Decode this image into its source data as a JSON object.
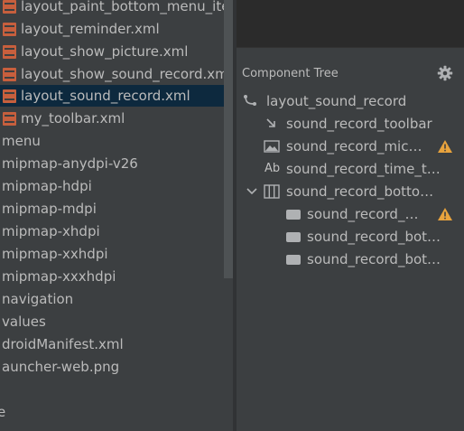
{
  "project_tree": {
    "items": [
      {
        "label": "layout_paint_bottom_menu_item",
        "icon": "xml-icon",
        "selected": false
      },
      {
        "label": "layout_reminder.xml",
        "icon": "xml-icon",
        "selected": false
      },
      {
        "label": "layout_show_picture.xml",
        "icon": "xml-icon",
        "selected": false
      },
      {
        "label": "layout_show_sound_record.xml",
        "icon": "xml-icon",
        "selected": false
      },
      {
        "label": "layout_sound_record.xml",
        "icon": "xml-icon",
        "selected": true
      },
      {
        "label": "my_toolbar.xml",
        "icon": "xml-icon",
        "selected": false
      },
      {
        "label": "menu",
        "icon": "",
        "selected": false
      },
      {
        "label": "mipmap-anydpi-v26",
        "icon": "",
        "selected": false
      },
      {
        "label": "mipmap-hdpi",
        "icon": "",
        "selected": false
      },
      {
        "label": "mipmap-mdpi",
        "icon": "",
        "selected": false
      },
      {
        "label": "mipmap-xhdpi",
        "icon": "",
        "selected": false
      },
      {
        "label": "mipmap-xxhdpi",
        "icon": "",
        "selected": false
      },
      {
        "label": "mipmap-xxxhdpi",
        "icon": "",
        "selected": false
      },
      {
        "label": "navigation",
        "icon": "",
        "selected": false
      },
      {
        "label": "values",
        "icon": "",
        "selected": false
      },
      {
        "label": "droidManifest.xml",
        "icon": "",
        "selected": false
      },
      {
        "label": "auncher-web.png",
        "icon": "",
        "selected": false
      },
      {
        "label": "e",
        "icon": "",
        "selected": false
      }
    ]
  },
  "component_tree": {
    "title": "Component Tree",
    "settings_icon": "gear-icon",
    "items": [
      {
        "label": "layout_sound_record",
        "icon": "constraint-layout-icon",
        "warning": false
      },
      {
        "label": "sound_record_toolbar",
        "icon": "include-arrow-icon",
        "warning": false
      },
      {
        "label": "sound_record_mic…",
        "icon": "image-view-icon",
        "warning": true
      },
      {
        "label": "sound_record_time_t…",
        "icon": "text-view-icon",
        "icon_text": "Ab",
        "warning": false
      },
      {
        "label": "sound_record_botto…",
        "icon": "linear-layout-icon",
        "warning": false,
        "expanded": true
      },
      {
        "label": "sound_record_…",
        "icon": "button-icon",
        "warning": true
      },
      {
        "label": "sound_record_bot…",
        "icon": "button-icon",
        "warning": false
      },
      {
        "label": "sound_record_bot…",
        "icon": "button-icon",
        "warning": false
      }
    ]
  },
  "colors": {
    "panel": "#3c3f41",
    "selected_row": "#0d293e",
    "xml_icon": "#c75f3d",
    "warning": "#e8a33d",
    "text": "#bbbbbb"
  }
}
